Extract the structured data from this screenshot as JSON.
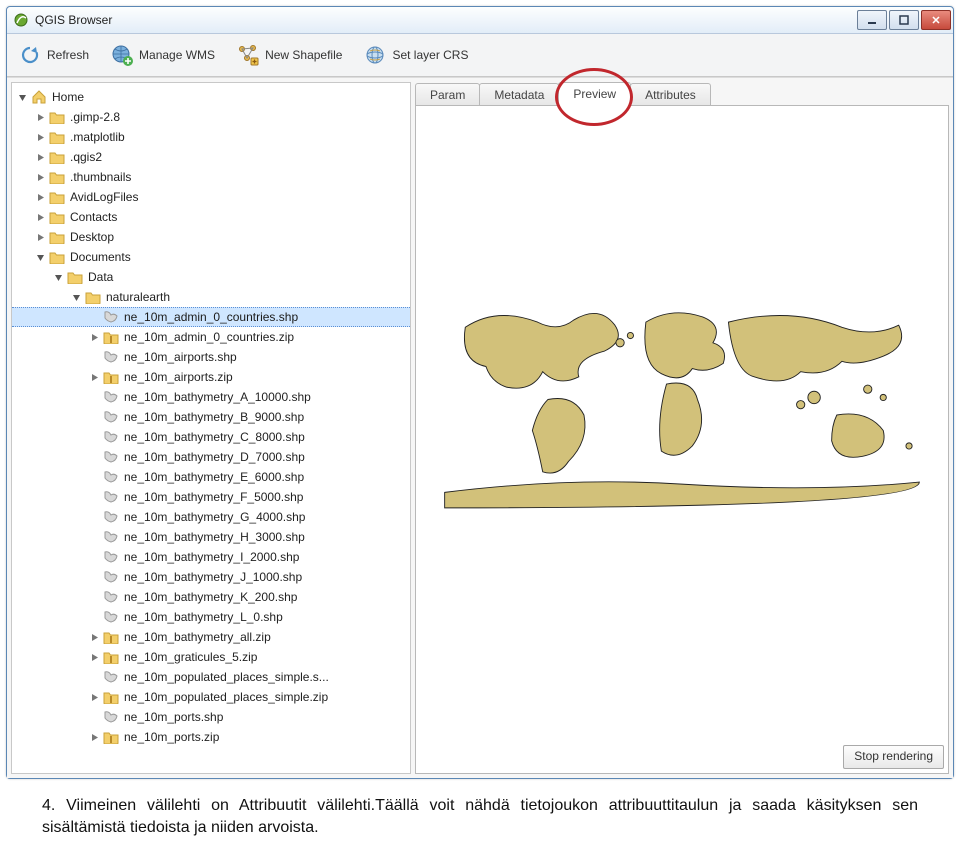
{
  "window": {
    "title": "QGIS Browser"
  },
  "toolbar": {
    "refresh": "Refresh",
    "manage_wms": "Manage WMS",
    "new_shapefile": "New Shapefile",
    "set_layer_crs": "Set layer CRS"
  },
  "tabs": {
    "param": "Param",
    "metadata": "Metadata",
    "preview": "Preview",
    "attributes": "Attributes"
  },
  "stop_rendering": "Stop rendering",
  "tree": {
    "home": "Home",
    "items": [
      {
        "label": ".gimp-2.8",
        "icon": "folder",
        "exp": "closed",
        "depth": 1
      },
      {
        "label": ".matplotlib",
        "icon": "folder",
        "exp": "closed",
        "depth": 1
      },
      {
        "label": ".qgis2",
        "icon": "folder",
        "exp": "closed",
        "depth": 1
      },
      {
        "label": ".thumbnails",
        "icon": "folder",
        "exp": "closed",
        "depth": 1
      },
      {
        "label": "AvidLogFiles",
        "icon": "folder",
        "exp": "closed",
        "depth": 1
      },
      {
        "label": "Contacts",
        "icon": "folder",
        "exp": "closed",
        "depth": 1
      },
      {
        "label": "Desktop",
        "icon": "folder",
        "exp": "closed",
        "depth": 1
      },
      {
        "label": "Documents",
        "icon": "folder",
        "exp": "open",
        "depth": 1
      },
      {
        "label": "Data",
        "icon": "folder",
        "exp": "open",
        "depth": 2
      },
      {
        "label": "naturalearth",
        "icon": "folder",
        "exp": "open",
        "depth": 3
      },
      {
        "label": "ne_10m_admin_0_countries.shp",
        "icon": "shp",
        "exp": "none",
        "depth": 4,
        "selected": true
      },
      {
        "label": "ne_10m_admin_0_countries.zip",
        "icon": "zip",
        "exp": "closed",
        "depth": 4
      },
      {
        "label": "ne_10m_airports.shp",
        "icon": "shp",
        "exp": "none",
        "depth": 4
      },
      {
        "label": "ne_10m_airports.zip",
        "icon": "zip",
        "exp": "closed",
        "depth": 4
      },
      {
        "label": "ne_10m_bathymetry_A_10000.shp",
        "icon": "shp",
        "exp": "none",
        "depth": 4
      },
      {
        "label": "ne_10m_bathymetry_B_9000.shp",
        "icon": "shp",
        "exp": "none",
        "depth": 4
      },
      {
        "label": "ne_10m_bathymetry_C_8000.shp",
        "icon": "shp",
        "exp": "none",
        "depth": 4
      },
      {
        "label": "ne_10m_bathymetry_D_7000.shp",
        "icon": "shp",
        "exp": "none",
        "depth": 4
      },
      {
        "label": "ne_10m_bathymetry_E_6000.shp",
        "icon": "shp",
        "exp": "none",
        "depth": 4
      },
      {
        "label": "ne_10m_bathymetry_F_5000.shp",
        "icon": "shp",
        "exp": "none",
        "depth": 4
      },
      {
        "label": "ne_10m_bathymetry_G_4000.shp",
        "icon": "shp",
        "exp": "none",
        "depth": 4
      },
      {
        "label": "ne_10m_bathymetry_H_3000.shp",
        "icon": "shp",
        "exp": "none",
        "depth": 4
      },
      {
        "label": "ne_10m_bathymetry_I_2000.shp",
        "icon": "shp",
        "exp": "none",
        "depth": 4
      },
      {
        "label": "ne_10m_bathymetry_J_1000.shp",
        "icon": "shp",
        "exp": "none",
        "depth": 4
      },
      {
        "label": "ne_10m_bathymetry_K_200.shp",
        "icon": "shp",
        "exp": "none",
        "depth": 4
      },
      {
        "label": "ne_10m_bathymetry_L_0.shp",
        "icon": "shp",
        "exp": "none",
        "depth": 4
      },
      {
        "label": "ne_10m_bathymetry_all.zip",
        "icon": "zip",
        "exp": "closed",
        "depth": 4
      },
      {
        "label": "ne_10m_graticules_5.zip",
        "icon": "zip",
        "exp": "closed",
        "depth": 4
      },
      {
        "label": "ne_10m_populated_places_simple.s...",
        "icon": "shp",
        "exp": "none",
        "depth": 4
      },
      {
        "label": "ne_10m_populated_places_simple.zip",
        "icon": "zip",
        "exp": "closed",
        "depth": 4
      },
      {
        "label": "ne_10m_ports.shp",
        "icon": "shp",
        "exp": "none",
        "depth": 4
      },
      {
        "label": "ne_10m_ports.zip",
        "icon": "zip",
        "exp": "closed",
        "depth": 4
      }
    ]
  },
  "caption": "4. Viimeinen välilehti on Attribuutit välilehti.Täällä voit nähdä tietojoukon attribuuttitaulun ja saada käsityksen sen sisältämistä tiedoista ja niiden arvoista."
}
